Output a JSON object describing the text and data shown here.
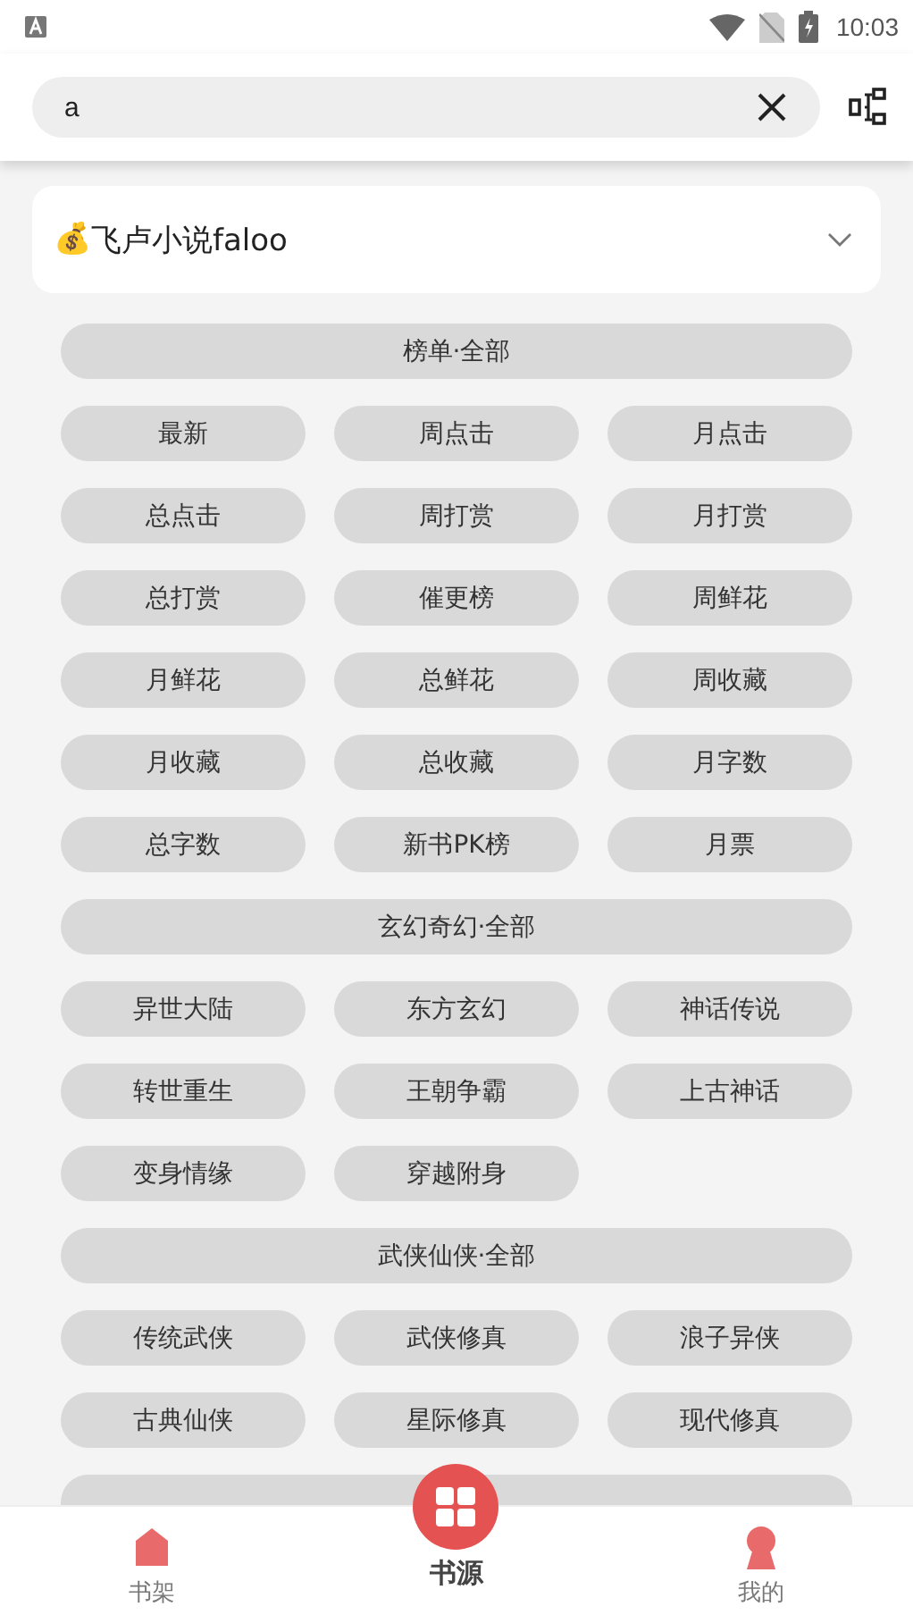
{
  "status_bar": {
    "time": "10:03"
  },
  "search": {
    "value": "a"
  },
  "source": {
    "icon": "💰",
    "name": "飞卢小说faloo",
    "expanded": false
  },
  "sections": [
    {
      "title": "榜单·全部",
      "items": [
        "最新",
        "周点击",
        "月点击",
        "总点击",
        "周打赏",
        "月打赏",
        "总打赏",
        "催更榜",
        "周鲜花",
        "月鲜花",
        "总鲜花",
        "周收藏",
        "月收藏",
        "总收藏",
        "月字数",
        "总字数",
        "新书PK榜",
        "月票"
      ]
    },
    {
      "title": "玄幻奇幻·全部",
      "items": [
        "异世大陆",
        "东方玄幻",
        "神话传说",
        "转世重生",
        "王朝争霸",
        "上古神话",
        "变身情缘",
        "穿越附身"
      ]
    },
    {
      "title": "武侠仙侠·全部",
      "items": [
        "传统武侠",
        "武侠修真",
        "浪子异侠",
        "古典仙侠",
        "星际修真",
        "现代修真"
      ]
    }
  ],
  "more_below": true,
  "bottom_nav": [
    {
      "label": "书架",
      "kind": "shelf",
      "selected": false
    },
    {
      "label": "书源",
      "kind": "source",
      "selected": true
    },
    {
      "label": "我的",
      "kind": "me",
      "selected": false
    }
  ]
}
